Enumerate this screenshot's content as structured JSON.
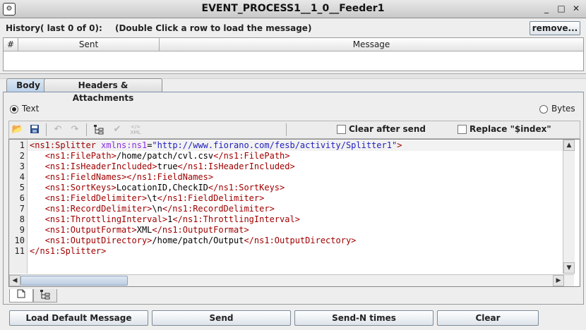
{
  "window": {
    "title": "EVENT_PROCESS1__1_0__Feeder1",
    "icon": "app-icon",
    "controls": [
      "_",
      "□",
      "✕"
    ]
  },
  "history": {
    "label": "History( last 0 of 0):",
    "hint": "(Double Click a row to load the message)",
    "remove_label": "remove...",
    "columns": [
      "#",
      "Sent",
      "Message"
    ],
    "rows": []
  },
  "tabs": [
    {
      "label": "Body",
      "selected": true
    },
    {
      "label": "Headers & Attachments",
      "selected": false
    }
  ],
  "body": {
    "format_options": [
      {
        "label": "Text",
        "selected": true
      },
      {
        "label": "Bytes",
        "selected": false
      }
    ],
    "toolbar": {
      "icons": [
        "open-folder-icon",
        "save-icon",
        "undo-icon",
        "redo-icon",
        "xml-tree-icon",
        "validate-icon",
        "xml-format-icon"
      ],
      "clear_after_send": {
        "label": "Clear after send",
        "checked": false
      },
      "replace_index": {
        "label": "Replace \"$index\"",
        "checked": false
      }
    },
    "editor": {
      "line_numbers": [
        "1",
        "2",
        "3",
        "4",
        "5",
        "6",
        "7",
        "8",
        "9",
        "10",
        "11"
      ],
      "lines": [
        [
          {
            "c": "tg",
            "t": "<ns1:Splitter "
          },
          {
            "c": "at",
            "t": "xmlns:ns1"
          },
          {
            "c": "tx",
            "t": "="
          },
          {
            "c": "vl",
            "t": "\"http://www.fiorano.com/fesb/activity/Splitter1\""
          },
          {
            "c": "tg",
            "t": ">"
          }
        ],
        [
          {
            "c": "tx",
            "t": "   "
          },
          {
            "c": "tg",
            "t": "<ns1:FilePath>"
          },
          {
            "c": "tx",
            "t": "/home/patch/cvl.csv"
          },
          {
            "c": "tg",
            "t": "</ns1:FilePath>"
          }
        ],
        [
          {
            "c": "tx",
            "t": "   "
          },
          {
            "c": "tg",
            "t": "<ns1:IsHeaderIncluded>"
          },
          {
            "c": "tx",
            "t": "true"
          },
          {
            "c": "tg",
            "t": "</ns1:IsHeaderIncluded>"
          }
        ],
        [
          {
            "c": "tx",
            "t": "   "
          },
          {
            "c": "tg",
            "t": "<ns1:FieldNames>"
          },
          {
            "c": "tg",
            "t": "</ns1:FieldNames>"
          }
        ],
        [
          {
            "c": "tx",
            "t": "   "
          },
          {
            "c": "tg",
            "t": "<ns1:SortKeys>"
          },
          {
            "c": "tx",
            "t": "LocationID,CheckID"
          },
          {
            "c": "tg",
            "t": "</ns1:SortKeys>"
          }
        ],
        [
          {
            "c": "tx",
            "t": "   "
          },
          {
            "c": "tg",
            "t": "<ns1:FieldDelimiter>"
          },
          {
            "c": "tx",
            "t": "\\t"
          },
          {
            "c": "tg",
            "t": "</ns1:FieldDelimiter>"
          }
        ],
        [
          {
            "c": "tx",
            "t": "   "
          },
          {
            "c": "tg",
            "t": "<ns1:RecordDelimiter>"
          },
          {
            "c": "tx",
            "t": "\\n"
          },
          {
            "c": "tg",
            "t": "</ns1:RecordDelimiter>"
          }
        ],
        [
          {
            "c": "tx",
            "t": "   "
          },
          {
            "c": "tg",
            "t": "<ns1:ThrottlingInterval>"
          },
          {
            "c": "tx",
            "t": "1"
          },
          {
            "c": "tg",
            "t": "</ns1:ThrottlingInterval>"
          }
        ],
        [
          {
            "c": "tx",
            "t": "   "
          },
          {
            "c": "tg",
            "t": "<ns1:OutputFormat>"
          },
          {
            "c": "tx",
            "t": "XML"
          },
          {
            "c": "tg",
            "t": "</ns1:OutputFormat>"
          }
        ],
        [
          {
            "c": "tx",
            "t": "   "
          },
          {
            "c": "tg",
            "t": "<ns1:OutputDirectory>"
          },
          {
            "c": "tx",
            "t": "/home/patch/Output"
          },
          {
            "c": "tg",
            "t": "</ns1:OutputDirectory>"
          }
        ],
        [
          {
            "c": "tg",
            "t": "</ns1:Splitter>"
          }
        ]
      ]
    },
    "view_tabs": [
      "text-view-icon",
      "tree-view-icon"
    ]
  },
  "actions": {
    "load_default": "Load Default Message",
    "send": "Send",
    "send_n": "Send-N times",
    "clear": "Clear"
  },
  "colors": {
    "tag": "#a00000",
    "attribute": "#8a2be2",
    "value": "#2020c0",
    "selected_tab": "#bcd1e8"
  }
}
